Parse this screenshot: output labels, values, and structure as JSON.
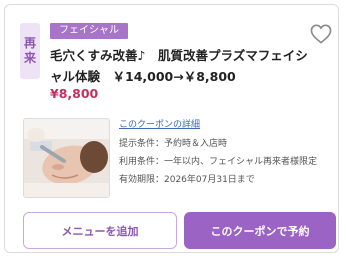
{
  "coupon": {
    "repeat_tag": [
      "再",
      "来"
    ],
    "category": "フェイシャル",
    "title": "毛穴くすみ改善♪　肌質改善プラズマフェイシャル体験　￥14,000→￥8,800",
    "price": "¥8,800",
    "details_link": "このクーポンの詳細",
    "conditions": [
      "提示条件：予約時＆入店時",
      "利用条件：一年以内、フェイシャル再来者様限定",
      "有効期限：2026年07月31日まで"
    ],
    "thumbnail_icon": "facial-treatment-photo",
    "favorite_icon": "heart-icon"
  },
  "buttons": {
    "add_menu": "メニューを追加",
    "reserve": "このクーポンで予約"
  },
  "colors": {
    "accent": "#9b63c3",
    "badge": "#a774c9",
    "tag_bg": "#eee2f6",
    "price": "#c4305b",
    "link": "#3a6ab8"
  }
}
